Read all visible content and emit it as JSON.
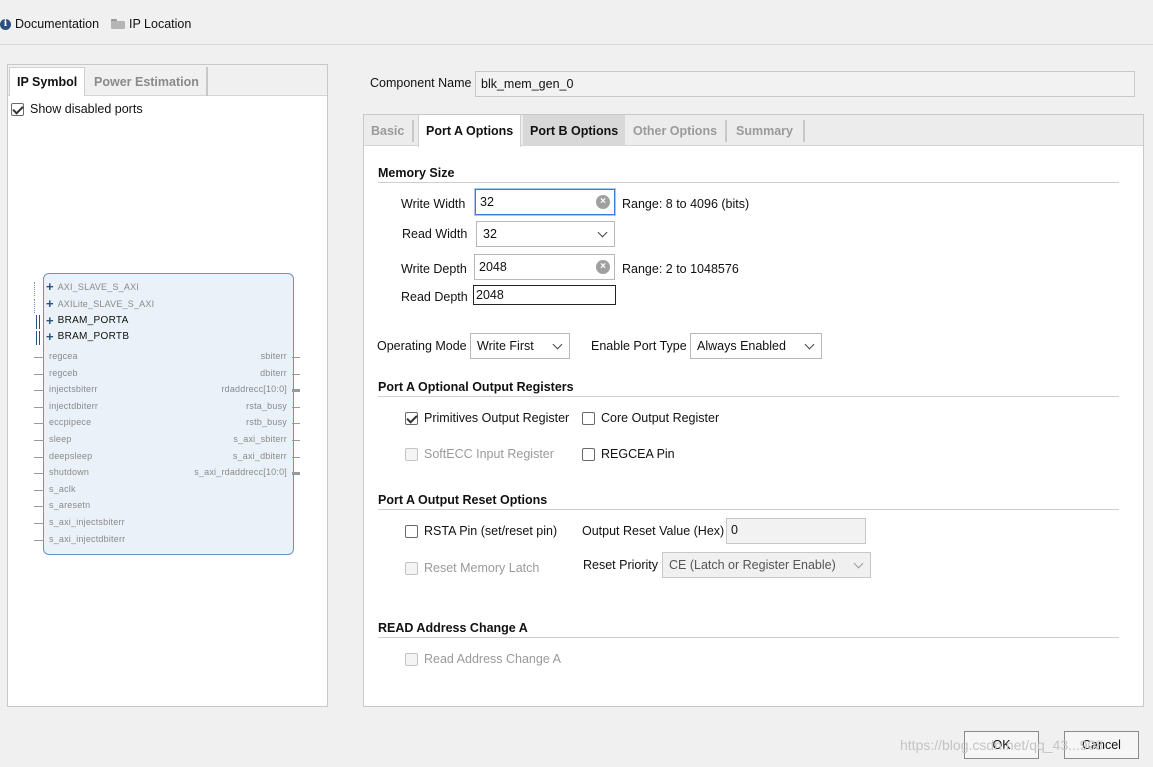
{
  "toolbar": {
    "documentation": "Documentation",
    "ip_location": "IP Location",
    "info_icon_text": "i"
  },
  "left_panel": {
    "tabs": [
      "IP Symbol",
      "Power Estimation"
    ],
    "show_disabled_ports": "Show disabled ports",
    "bus_ports": [
      "AXI_SLAVE_S_AXI",
      "AXILite_SLAVE_S_AXI",
      "BRAM_PORTA",
      "BRAM_PORTB"
    ],
    "input_ports": [
      "regcea",
      "regceb",
      "injectsbiterr",
      "injectdbiterr",
      "eccpipece",
      "sleep",
      "deepsleep",
      "shutdown",
      "s_aclk",
      "s_aresetn",
      "s_axi_injectsbiterr",
      "s_axi_injectdbiterr"
    ],
    "output_ports": [
      "sbiterr",
      "dbiterr",
      "rdaddrecc[10:0]",
      "rsta_busy",
      "rstb_busy",
      "s_axi_sbiterr",
      "s_axi_dbiterr",
      "s_axi_rdaddrecc[10:0]"
    ]
  },
  "component": {
    "label": "Component Name",
    "value": "blk_mem_gen_0"
  },
  "tabs": [
    "Basic",
    "Port A Options",
    "Port B Options",
    "Other Options",
    "Summary"
  ],
  "memory_size": {
    "title": "Memory Size",
    "write_width_label": "Write Width",
    "write_width": "32",
    "write_width_range": "Range: 8 to 4096 (bits)",
    "read_width_label": "Read Width",
    "read_width": "32",
    "write_depth_label": "Write Depth",
    "write_depth": "2048",
    "write_depth_range": "Range: 2 to 1048576",
    "read_depth_label": "Read Depth",
    "read_depth": "2048"
  },
  "mode": {
    "operating_mode_label": "Operating Mode",
    "operating_mode": "Write First",
    "enable_port_type_label": "Enable Port Type",
    "enable_port_type": "Always Enabled"
  },
  "optional_output_registers": {
    "title": "Port A Optional Output Registers",
    "primitives": "Primitives Output Register",
    "core": "Core Output Register",
    "softecc": "SoftECC Input Register",
    "regcea": "REGCEA Pin"
  },
  "output_reset": {
    "title": "Port A Output Reset Options",
    "rsta_pin": "RSTA Pin (set/reset pin)",
    "reset_value_label": "Output Reset Value (Hex)",
    "reset_value": "0",
    "reset_memory_latch": "Reset Memory Latch",
    "reset_priority_label": "Reset Priority",
    "reset_priority": "CE (Latch or Register Enable)"
  },
  "read_address": {
    "title": "READ Address Change A",
    "checkbox": "Read Address Change A"
  },
  "buttons": {
    "ok": "OK",
    "cancel": "Cancel"
  },
  "watermark": "https://blog.csdn.net/qq_43...908",
  "icons": {
    "clear": "×"
  }
}
